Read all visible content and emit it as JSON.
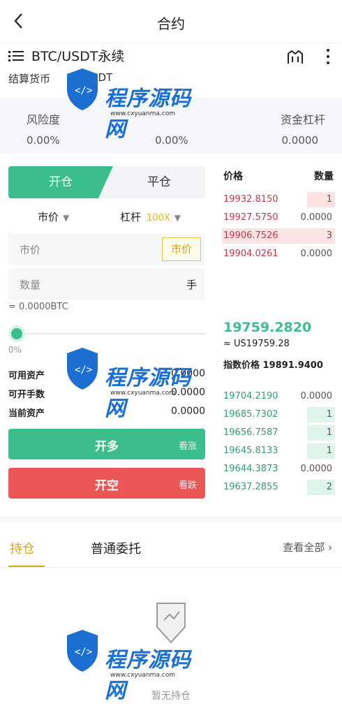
{
  "header": {
    "back_icon": "chevron-left-icon",
    "title": "合约"
  },
  "pair": {
    "menu_icon": "list-icon",
    "name": "BTC/USDT永续",
    "kline_icon": "kline-icon",
    "more_icon": "more-vert-icon"
  },
  "settle": {
    "label": "结算货币",
    "value": "USDT"
  },
  "risk": {
    "risk_label": "风险度",
    "risk_value": "0.00%",
    "mid_value": "0.00%",
    "leverage_label": "资金杠杆",
    "leverage_value": "0.0000"
  },
  "order": {
    "tab_open": "开仓",
    "tab_close": "平仓",
    "type_label": "市价",
    "leverage_label": "杠杆",
    "leverage_value": "100X",
    "price_placeholder": "市价",
    "market_button": "市价",
    "amount_placeholder": "数量",
    "amount_unit": "手",
    "btc_equiv": "= 0.0000BTC",
    "slider_percent": 0,
    "slider_label": "0%",
    "available_label": "可用资产",
    "available_value": "0.0000",
    "openable_label": "可开手数",
    "openable_value": "0.0000",
    "current_label": "当前资产",
    "current_value": "0.0000",
    "buy_label": "开多",
    "buy_sub": "看涨",
    "sell_label": "开空",
    "sell_sub": "看跌"
  },
  "orderbook": {
    "price_header": "价格",
    "qty_header": "数量",
    "asks": [
      {
        "price": "19932.8150",
        "qty": "1"
      },
      {
        "price": "19927.5750",
        "qty": "0.0000"
      },
      {
        "price": "19906.7526",
        "qty": "3"
      },
      {
        "price": "19904.0261",
        "qty": "0.0000"
      }
    ],
    "last_price": "19759.2820",
    "usd_price": "≈ US19759.28",
    "index_label": "指数价格",
    "index_value": "19891.9400",
    "bids": [
      {
        "price": "19704.2190",
        "qty": "0.0000"
      },
      {
        "price": "19685.7302",
        "qty": "1"
      },
      {
        "price": "19656.7587",
        "qty": "1"
      },
      {
        "price": "19645.8133",
        "qty": "1"
      },
      {
        "price": "19644.3873",
        "qty": "0.0000"
      },
      {
        "price": "19637.2855",
        "qty": "2"
      }
    ],
    "ask_color": "#c0394b",
    "bid_color": "#3bbd8c"
  },
  "bottom": {
    "tab_positions": "持仓",
    "tab_orders": "普通委托",
    "view_all": "查看全部",
    "empty_text": "暂无持仓"
  },
  "watermark": {
    "text": "程序源码网",
    "url": "www.cxyuanma.com"
  },
  "colors": {
    "green": "#3bbd8c",
    "red": "#eb5757",
    "gold": "#d1a81b"
  }
}
